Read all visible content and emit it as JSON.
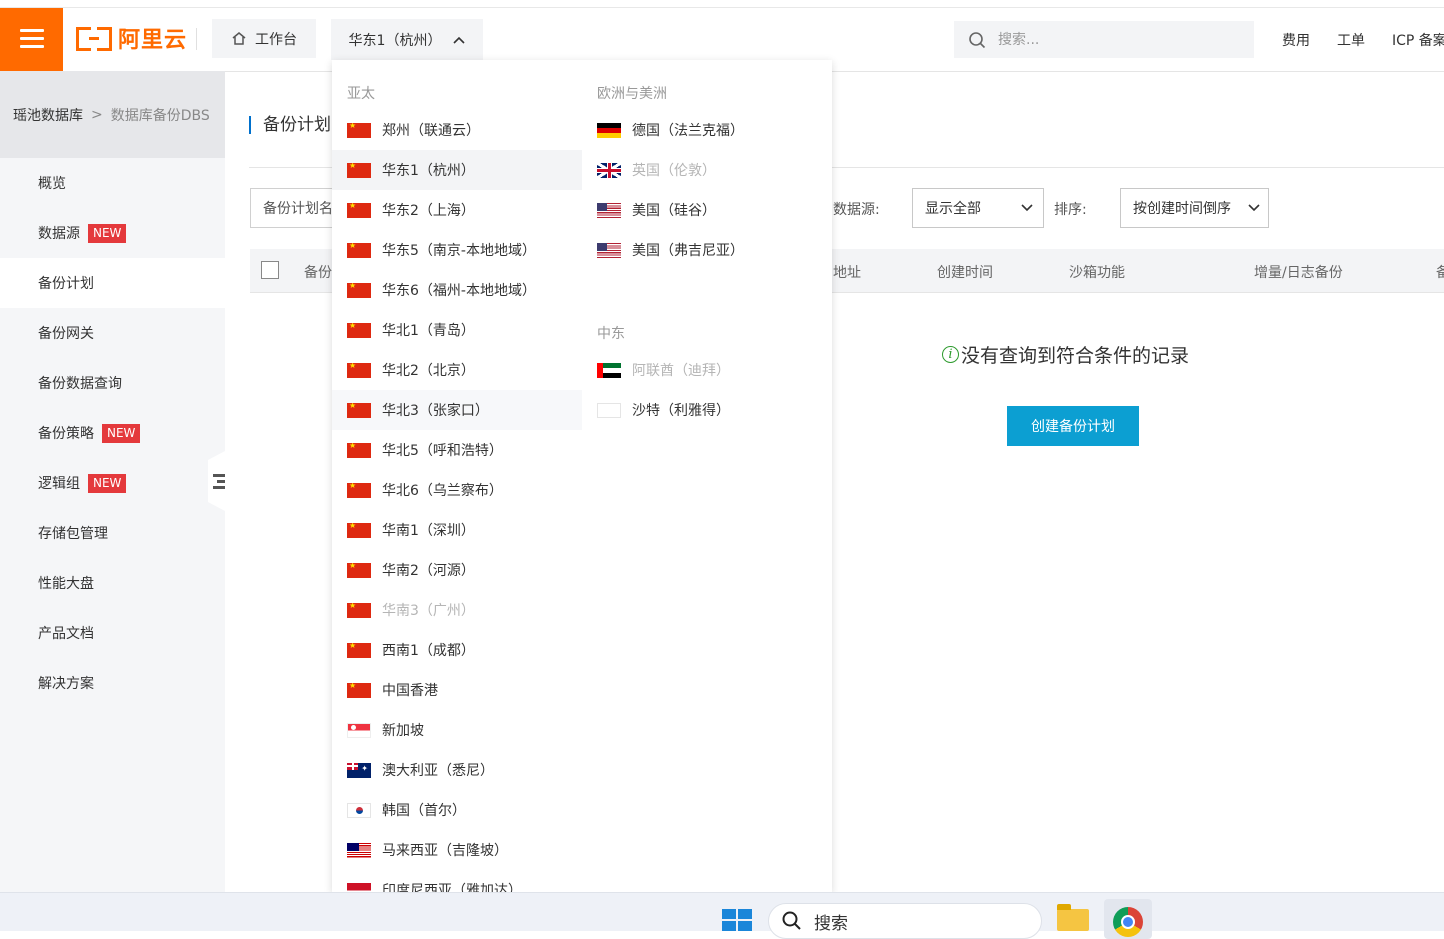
{
  "header": {
    "logo_text": "阿里云",
    "workbench_label": "工作台",
    "region_label": "华东1（杭州）",
    "search_placeholder": "搜索...",
    "links": [
      "费用",
      "工单",
      "ICP 备案"
    ]
  },
  "sidebar": {
    "breadcrumb": {
      "root": "瑶池数据库",
      "sep": ">",
      "current": "数据库备份DBS"
    },
    "items": [
      {
        "label": "概览",
        "badge": ""
      },
      {
        "label": "数据源",
        "badge": "NEW"
      },
      {
        "label": "备份计划",
        "badge": "",
        "active": true
      },
      {
        "label": "备份网关",
        "badge": ""
      },
      {
        "label": "备份数据查询",
        "badge": ""
      },
      {
        "label": "备份策略",
        "badge": "NEW"
      },
      {
        "label": "逻辑组",
        "badge": "NEW"
      },
      {
        "label": "存储包管理",
        "badge": ""
      },
      {
        "label": "性能大盘",
        "badge": ""
      },
      {
        "label": "产品文档",
        "badge": ""
      },
      {
        "label": "解决方案",
        "badge": ""
      }
    ]
  },
  "main": {
    "title": "备份计划",
    "plan_filter": "备份计划名",
    "source_label": "数据源:",
    "source_value": "显示全部",
    "sort_label": "排序:",
    "sort_value": "按创建时间倒序",
    "columns": [
      "备份",
      "地址",
      "创建时间",
      "沙箱功能",
      "增量/日志备份",
      "备"
    ],
    "empty_message": "没有查询到符合条件的记录",
    "create_button": "创建备份计划"
  },
  "dropdown": {
    "groups": [
      {
        "title": "亚太",
        "regions": [
          {
            "name": "郑州（联通云）",
            "flag": "cn"
          },
          {
            "name": "华东1（杭州）",
            "flag": "cn",
            "state": "selected"
          },
          {
            "name": "华东2（上海）",
            "flag": "cn"
          },
          {
            "name": "华东5（南京-本地地域）",
            "flag": "cn"
          },
          {
            "name": "华东6（福州-本地地域）",
            "flag": "cn"
          },
          {
            "name": "华北1（青岛）",
            "flag": "cn"
          },
          {
            "name": "华北2（北京）",
            "flag": "cn"
          },
          {
            "name": "华北3（张家口）",
            "flag": "cn",
            "state": "hover"
          },
          {
            "name": "华北5（呼和浩特）",
            "flag": "cn"
          },
          {
            "name": "华北6（乌兰察布）",
            "flag": "cn"
          },
          {
            "name": "华南1（深圳）",
            "flag": "cn"
          },
          {
            "name": "华南2（河源）",
            "flag": "cn"
          },
          {
            "name": "华南3（广州）",
            "flag": "cn",
            "state": "disabled"
          },
          {
            "name": "西南1（成都）",
            "flag": "cn"
          },
          {
            "name": "中国香港",
            "flag": "cn"
          },
          {
            "name": "新加坡",
            "flag": "sg"
          },
          {
            "name": "澳大利亚（悉尼）",
            "flag": "au"
          },
          {
            "name": "韩国（首尔）",
            "flag": "kr"
          },
          {
            "name": "马来西亚（吉隆坡）",
            "flag": "my"
          },
          {
            "name": "印度尼西亚（雅加达）",
            "flag": "id"
          }
        ]
      },
      {
        "title": "欧洲与美洲",
        "regions": [
          {
            "name": "德国（法兰克福）",
            "flag": "de"
          },
          {
            "name": "英国（伦敦）",
            "flag": "gb",
            "state": "disabled"
          },
          {
            "name": "美国（硅谷）",
            "flag": "us"
          },
          {
            "name": "美国（弗吉尼亚）",
            "flag": "us"
          }
        ]
      },
      {
        "title": "中东",
        "regions": [
          {
            "name": "阿联酋（迪拜）",
            "flag": "ae",
            "state": "disabled"
          },
          {
            "name": "沙特（利雅得）",
            "flag": "sa"
          }
        ]
      }
    ]
  },
  "taskbar": {
    "search_label": "搜索"
  },
  "colors": {
    "brand": "#ff6a00",
    "primary_button": "#0c9fd2",
    "new_badge": "#e4393c"
  }
}
